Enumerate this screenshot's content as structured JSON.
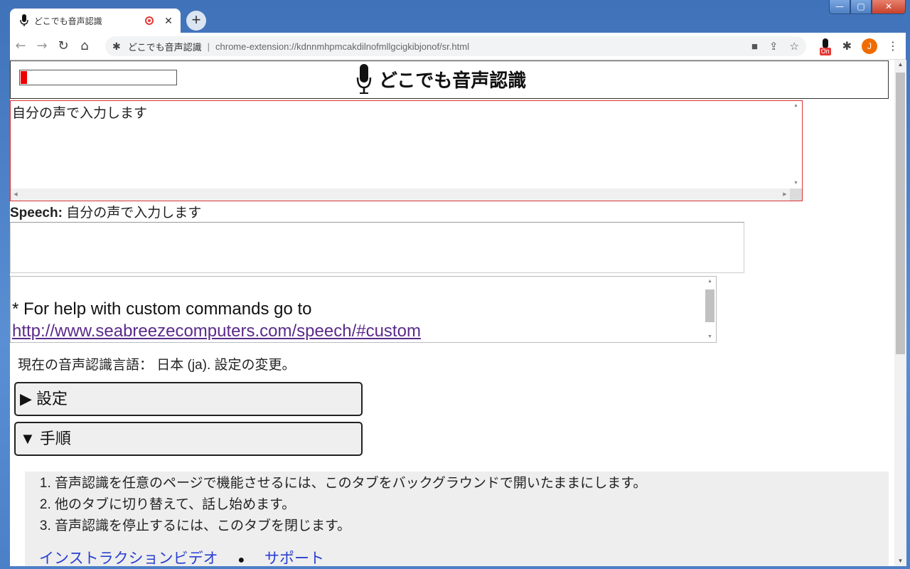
{
  "window": {
    "controls": {
      "minimize": "—",
      "maximize": "▢",
      "close": "✕"
    }
  },
  "tab": {
    "title": "どこでも音声認識",
    "close_glyph": "✕",
    "newtab_glyph": "+"
  },
  "toolbar": {
    "back_glyph": "←",
    "forward_glyph": "→",
    "reload_glyph": "↻",
    "home_glyph": "⌂",
    "site_name": "どこでも音声認識",
    "separator": "|",
    "url": "chrome-extension://kdnnmhpmcakdilnofmllgcigkibjonof/sr.html",
    "extension_badge": "On",
    "avatar_letter": "J"
  },
  "page": {
    "title": "どこでも音声認識",
    "level_meter_fraction": 0.04,
    "transcript": "自分の声で入力します",
    "speech_label": "Speech:",
    "speech_text": "自分の声で入力します",
    "help_text": "* For help with custom commands go to",
    "help_link": "http://www.seabreezecomputers.com/speech/#custom",
    "language_line": "現在の音声認識言語： 日本 (ja). 設定の変更。",
    "settings_label": "▶ 設定",
    "steps_label": "▼ 手順",
    "steps": [
      "音声認識を任意のページで機能させるには、このタブをバックグラウンドで開いたままにします。",
      "他のタブに切り替えて、話し始めます。",
      "音声認識を停止するには、このタブを閉じます。"
    ],
    "link_video": "インストラクションビデオ",
    "link_bullet": "●",
    "link_support": "サポート"
  }
}
